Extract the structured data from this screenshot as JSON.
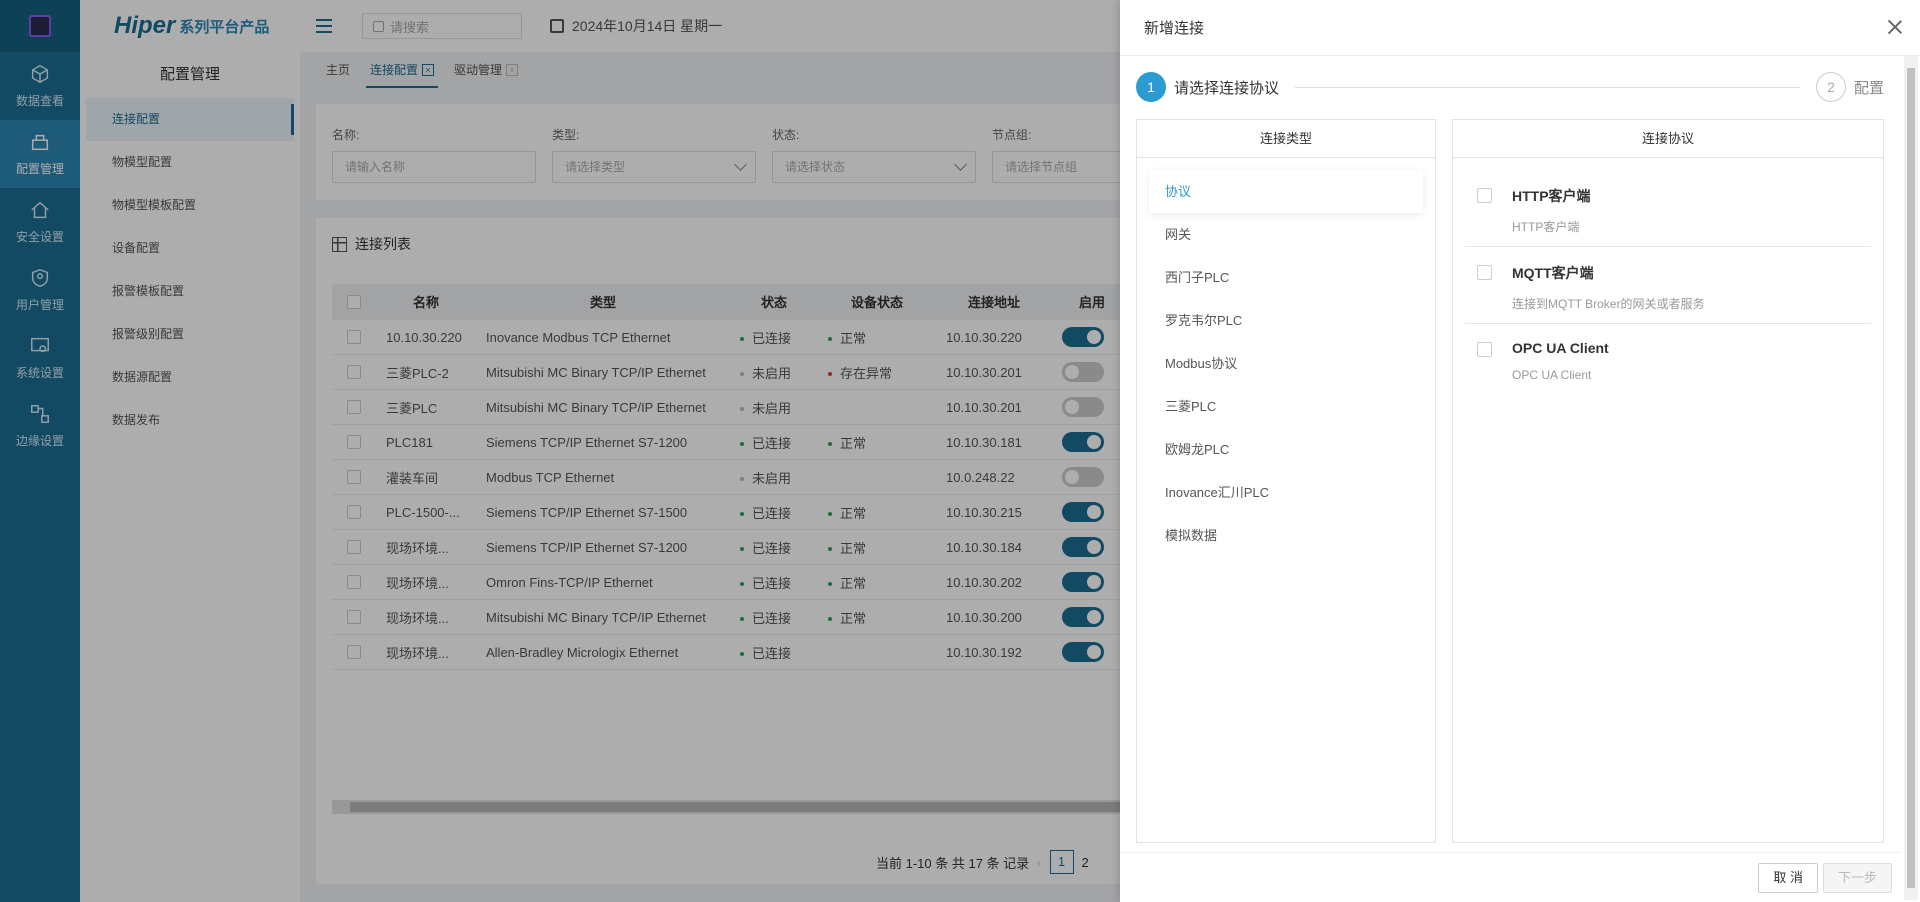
{
  "rail": {
    "items": [
      {
        "label": "数据查看",
        "icon": "cube-icon"
      },
      {
        "label": "配置管理",
        "icon": "config-icon",
        "active": true
      },
      {
        "label": "安全设置",
        "icon": "home-lock-icon"
      },
      {
        "label": "用户管理",
        "icon": "shield-user-icon"
      },
      {
        "label": "系统设置",
        "icon": "system-settings-icon"
      },
      {
        "label": "边缘设置",
        "icon": "edge-icon"
      }
    ]
  },
  "brand": {
    "name": "Hiper",
    "suffix": "系列平台产品"
  },
  "submenu": {
    "title": "配置管理",
    "items": [
      "连接配置",
      "物模型配置",
      "物模型模板配置",
      "设备配置",
      "报警模板配置",
      "报警级别配置",
      "数据源配置",
      "数据发布"
    ]
  },
  "topbar": {
    "search_placeholder": "请搜索",
    "date": "2024年10月14日 星期一"
  },
  "tabs": [
    {
      "label": "主页"
    },
    {
      "label": "连接配置",
      "active": true
    },
    {
      "label": "驱动管理"
    }
  ],
  "filters": [
    {
      "label": "名称:",
      "placeholder": "请输入名称",
      "dropdown": false
    },
    {
      "label": "类型:",
      "placeholder": "请选择类型",
      "dropdown": true
    },
    {
      "label": "状态:",
      "placeholder": "请选择状态",
      "dropdown": true
    },
    {
      "label": "节点组:",
      "placeholder": "请选择节点组",
      "dropdown": false
    }
  ],
  "table": {
    "title": "连接列表",
    "columns": [
      "名称",
      "类型",
      "状态",
      "设备状态",
      "连接地址",
      "启用"
    ],
    "rows": [
      {
        "name": "10.10.30.220",
        "type": "Inovance Modbus TCP Ethernet",
        "state": "已连接",
        "dev": "正常",
        "addr": "10.10.30.220",
        "on": true
      },
      {
        "name": "三菱PLC-2",
        "type": "Mitsubishi MC Binary TCP/IP Ethernet",
        "state": "未启用",
        "dev": "存在异常",
        "addr": "10.10.30.201",
        "on": false
      },
      {
        "name": "三菱PLC",
        "type": "Mitsubishi MC Binary TCP/IP Ethernet",
        "state": "未启用",
        "dev": "",
        "addr": "10.10.30.201",
        "on": false
      },
      {
        "name": "PLC181",
        "type": "Siemens TCP/IP Ethernet S7-1200",
        "state": "已连接",
        "dev": "正常",
        "addr": "10.10.30.181",
        "on": true
      },
      {
        "name": "灌装车间",
        "type": "Modbus TCP Ethernet",
        "state": "未启用",
        "dev": "",
        "addr": "10.0.248.22",
        "on": false
      },
      {
        "name": "PLC-1500-...",
        "type": "Siemens TCP/IP Ethernet S7-1500",
        "state": "已连接",
        "dev": "正常",
        "addr": "10.10.30.215",
        "on": true
      },
      {
        "name": "现场环境...",
        "type": "Siemens TCP/IP Ethernet S7-1200",
        "state": "已连接",
        "dev": "正常",
        "addr": "10.10.30.184",
        "on": true
      },
      {
        "name": "现场环境...",
        "type": "Omron Fins-TCP/IP Ethernet",
        "state": "已连接",
        "dev": "正常",
        "addr": "10.10.30.202",
        "on": true
      },
      {
        "name": "现场环境...",
        "type": "Mitsubishi MC Binary TCP/IP Ethernet",
        "state": "已连接",
        "dev": "正常",
        "addr": "10.10.30.200",
        "on": true
      },
      {
        "name": "现场环境...",
        "type": "Allen-Bradley Micrologix Ethernet",
        "state": "已连接",
        "dev": "",
        "addr": "10.10.30.192",
        "on": true
      }
    ],
    "colors": {
      "ok": "#2e9e5b",
      "off": "#bbbbbb",
      "error": "#e23b3b"
    }
  },
  "pager": {
    "summary": "当前 1-10 条 共 17 条 记录",
    "current": "1",
    "next": "2"
  },
  "drawer": {
    "title": "新增连接",
    "steps": [
      {
        "num": "1",
        "label": "请选择连接协议"
      },
      {
        "num": "2",
        "label": "配置"
      }
    ],
    "left_head": "连接类型",
    "right_head": "连接协议",
    "types": [
      "协议",
      "网关",
      "西门子PLC",
      "罗克韦尔PLC",
      "Modbus协议",
      "三菱PLC",
      "欧姆龙PLC",
      "Inovance汇川PLC",
      "模拟数据"
    ],
    "protocols": [
      {
        "title": "HTTP客户端",
        "desc": "HTTP客户端"
      },
      {
        "title": "MQTT客户端",
        "desc": "连接到MQTT Broker的网关或者服务"
      },
      {
        "title": "OPC UA Client",
        "desc": "OPC UA Client"
      }
    ],
    "cancel": "取 消",
    "next": "下一步"
  }
}
